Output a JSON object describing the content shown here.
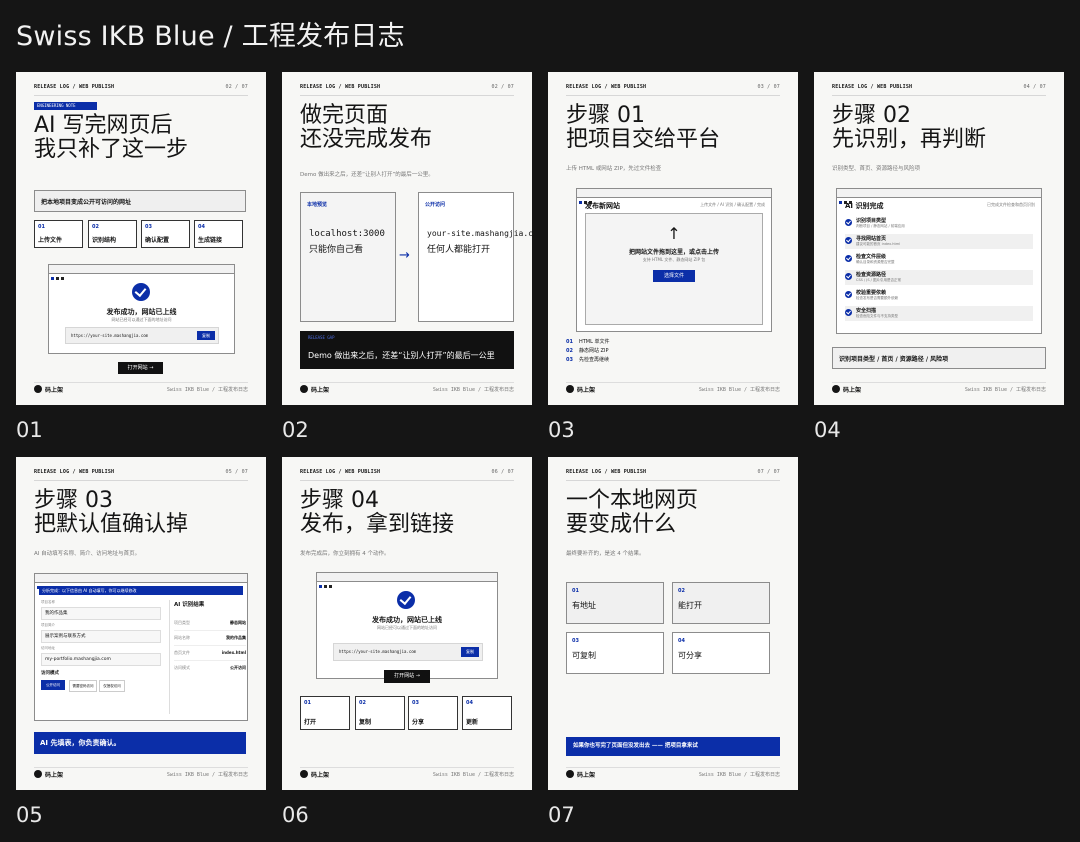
{
  "page_title": "Swiss IKB Blue / 工程发布日志",
  "cards": [
    {
      "index_label": "01",
      "topbar_left": "RELEASE LOG / WEB PUBLISH",
      "topbar_right": "02 / 07",
      "tag": "ENGINEERING NOTE",
      "headline": [
        "AI 写完网页后",
        "我只补了这一步"
      ],
      "panel_title": "把本地项目变成公开可访问的网址",
      "steps": [
        {
          "n": "01",
          "label": "上传文件"
        },
        {
          "n": "02",
          "label": "识别结构"
        },
        {
          "n": "03",
          "label": "确认配置"
        },
        {
          "n": "04",
          "label": "生成链接"
        }
      ],
      "success_title": "发布成功，网站已上线",
      "success_sub": "网站已经可以通过下面的地址访问",
      "url": "https://your-site.mashangjia.com",
      "copy_button": "复制",
      "open_button": "打开网站 →",
      "brand": "码上架",
      "footer_meta": "Swiss IKB Blue / 工程发布日志"
    },
    {
      "index_label": "02",
      "topbar_left": "RELEASE LOG / WEB PUBLISH",
      "topbar_right": "02 / 07",
      "headline": [
        "做完页面",
        "还没完成发布"
      ],
      "subtitle": "Demo 做出来之后，还差“让别人打开”的最后一公里。",
      "left_box_label": "本地预览",
      "left_box_line1": "localhost:3000",
      "left_box_line2": "只能你自己看",
      "arrow": "→",
      "right_box_label": "公开访问",
      "right_box_line1": "your-site.mashangjia.com",
      "right_box_line2": "任何人都能打开",
      "release_gap_label": "RELEASE GAP",
      "release_gap_text": "Demo 做出来之后，还差“让别人打开”的最后一公里",
      "brand": "码上架",
      "footer_meta": "Swiss IKB Blue / 工程发布日志"
    },
    {
      "index_label": "03",
      "topbar_left": "RELEASE LOG / WEB PUBLISH",
      "topbar_right": "03 / 07",
      "headline": [
        "步骤 01",
        "把项目交给平台"
      ],
      "subtitle": "上传 HTML 或网站 ZIP，先过文件检查",
      "panel_title": "发布新网站",
      "panel_tabs": "上传文件 / AI 识别 / 确认配置 / 完成",
      "upload_arrow": "↑",
      "upload_title": "把网站文件拖到这里，或点击上传",
      "upload_sub": "支持 HTML 文件、静态网站 ZIP 包",
      "upload_button": "选择文件",
      "list": [
        {
          "n": "01",
          "label": "HTML 单文件"
        },
        {
          "n": "02",
          "label": "静态网站 ZIP"
        },
        {
          "n": "03",
          "label": "先检查再继续"
        }
      ],
      "brand": "码上架",
      "footer_meta": "Swiss IKB Blue / 工程发布日志"
    },
    {
      "index_label": "04",
      "topbar_left": "RELEASE LOG / WEB PUBLISH",
      "topbar_right": "04 / 07",
      "headline": [
        "步骤 02",
        "先识别，再判断"
      ],
      "subtitle": "识别类型、首页、资源路径与风险项",
      "panel_title": "AI 识别完成",
      "panel_note": "已完成文件检查和首页识别",
      "items": [
        {
          "t": "识别项目类型",
          "s": "判断项目 / 静态网站 / 前端应用"
        },
        {
          "t": "寻找网站首页",
          "s": "建议可能的首页 index.html"
        },
        {
          "t": "检查文件层级",
          "s": "确认目录和资源是否完整"
        },
        {
          "t": "检查资源路径",
          "s": "CSS / JS / 图片引用是否正常"
        },
        {
          "t": "校验重要依赖",
          "s": "检查发布是否需要额外依赖"
        },
        {
          "t": "安全扫描",
          "s": "检查危险文件与不支持类型"
        }
      ],
      "summary": "识别项目类型 / 首页 / 资源路径 / 风险项",
      "brand": "码上架",
      "footer_meta": "Swiss IKB Blue / 工程发布日志"
    },
    {
      "index_label": "05",
      "topbar_left": "RELEASE LOG / WEB PUBLISH",
      "topbar_right": "05 / 07",
      "headline": [
        "步骤 03",
        "把默认值确认掉"
      ],
      "subtitle": "AI 自动填写名称、简介、访问地址与首页。",
      "banner": "分析完成：以下信息由 AI 自动填写，你可以继续修改",
      "fields": [
        {
          "label": "项目名称",
          "value": "我的作品集"
        },
        {
          "label": "项目简介",
          "value": "展示案例与联系方式"
        },
        {
          "label": "访问地址",
          "value": "my-portfolio.mashangjia.com"
        }
      ],
      "mode_label": "访问模式",
      "mode_buttons": [
        "公开访问",
        "需要密码访问",
        "仅授权访问"
      ],
      "result_title": "AI 识别结果",
      "results": [
        {
          "k": "项目类型",
          "v": "静态网站"
        },
        {
          "k": "网站名称",
          "v": "我的作品集"
        },
        {
          "k": "首页文件",
          "v": "index.html"
        },
        {
          "k": "访问模式",
          "v": "公开访问"
        }
      ],
      "blue_bar": "AI 先填表，你负责确认。",
      "brand": "码上架",
      "footer_meta": "Swiss IKB Blue / 工程发布日志"
    },
    {
      "index_label": "06",
      "topbar_left": "RELEASE LOG / WEB PUBLISH",
      "topbar_right": "06 / 07",
      "headline": [
        "步骤 04",
        "发布，拿到链接"
      ],
      "subtitle": "发布完成后，你立刻拥有 4 个动作。",
      "success_title": "发布成功，网站已上线",
      "success_sub": "网站已经可以通过下面的地址访问",
      "url": "https://your-site.mashangjia.com",
      "copy_button": "复制",
      "open_button": "打开网站 →",
      "actions": [
        {
          "n": "01",
          "label": "打开"
        },
        {
          "n": "02",
          "label": "复制"
        },
        {
          "n": "03",
          "label": "分享"
        },
        {
          "n": "04",
          "label": "更新"
        }
      ],
      "brand": "码上架",
      "footer_meta": "Swiss IKB Blue / 工程发布日志"
    },
    {
      "index_label": "07",
      "topbar_left": "RELEASE LOG / WEB PUBLISH",
      "topbar_right": "07 / 07",
      "headline": [
        "一个本地网页",
        "要变成什么"
      ],
      "subtitle": "最终要补齐的，是这 4 个结果。",
      "results": [
        {
          "n": "01",
          "label": "有地址"
        },
        {
          "n": "02",
          "label": "能打开"
        },
        {
          "n": "03",
          "label": "可复制"
        },
        {
          "n": "04",
          "label": "可分享"
        }
      ],
      "cta": "如果你也写完了页面但没发出去 —— 把项目拿来试",
      "brand": "码上架",
      "footer_meta": "Swiss IKB Blue / 工程发布日志"
    }
  ]
}
